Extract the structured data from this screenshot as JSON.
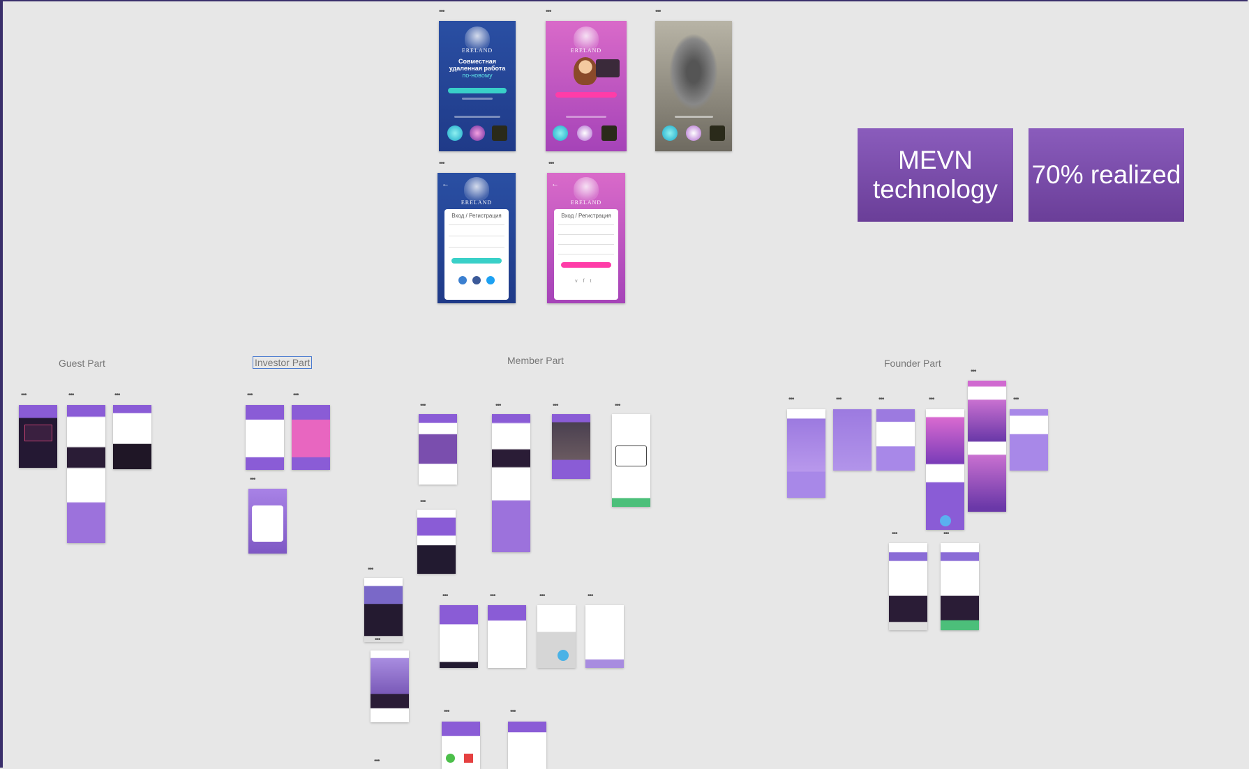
{
  "badges": [
    {
      "text": "MEVN technology"
    },
    {
      "text": "70% realized"
    }
  ],
  "sections": {
    "guest": "Guest Part",
    "investor": "Investor Part",
    "member": "Member Part",
    "founder": "Founder Part"
  },
  "login_screens": {
    "headline_line1": "Совместная",
    "headline_line2": "удаленная работа",
    "headline_accent": "по-новому",
    "login_title": "Вход / Регистрация",
    "brand": "ERELAND"
  },
  "colors": {
    "badge": "#7a4eae",
    "canvas": "#e7e7e7",
    "selection": "#4a7bd0",
    "border": "#3a2f6b"
  }
}
